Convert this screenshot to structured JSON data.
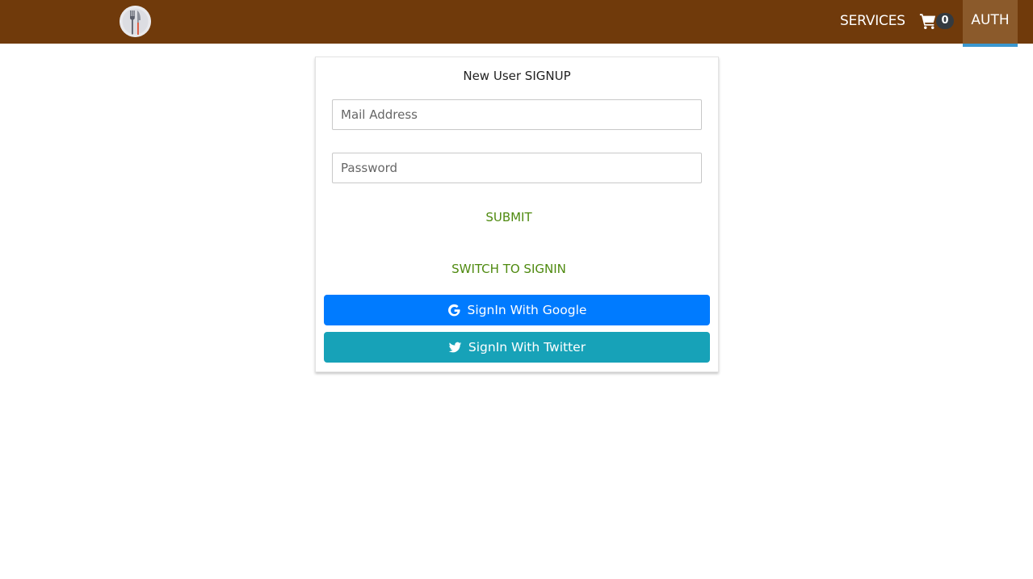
{
  "header": {
    "nav": {
      "services_label": "SERVICES",
      "cart_count": "0",
      "auth_label": "AUTH"
    },
    "colors": {
      "bar": "#703a0b",
      "active_tab": "#8b5a2b",
      "active_underline": "#3a97cf",
      "badge": "#343a40"
    },
    "icons": [
      "restaurant-logo-icon",
      "shopping-cart-icon"
    ]
  },
  "signup_card": {
    "title": "New User SIGNUP",
    "email": {
      "placeholder": "Mail Address",
      "value": ""
    },
    "password": {
      "placeholder": "Password",
      "value": ""
    },
    "submit_label": "SUBMIT",
    "switch_label": "SWITCH TO SIGNIN",
    "google_label": "SignIn With Google",
    "twitter_label": "SignIn With Twitter",
    "colors": {
      "text_button": "#4f8a10",
      "google": "#007bff",
      "twitter": "#17a2b8"
    },
    "icons": [
      "google-icon",
      "twitter-icon"
    ]
  }
}
